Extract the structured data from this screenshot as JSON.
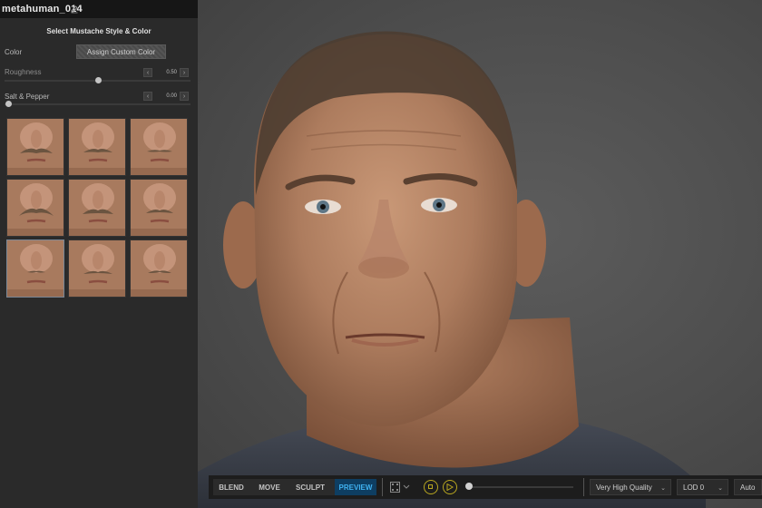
{
  "panel": {
    "title": "metahuman_014",
    "section_title": "Select Mustache Style & Color",
    "color": {
      "label": "Color",
      "button_label": "Assign Custom Color"
    },
    "roughness": {
      "label": "Roughness",
      "value": "0.50",
      "level": 0.5
    },
    "salt_pepper": {
      "label": "Salt & Pepper",
      "value": "0.00",
      "level": 0.0
    },
    "styles_count": 9,
    "selected_style_index": 6
  },
  "toolbar": {
    "modes": [
      "BLEND",
      "MOVE",
      "SCULPT",
      "PREVIEW"
    ],
    "active_mode": "PREVIEW",
    "quality": "Very High Quality",
    "lod": "LOD 0",
    "auto": "Auto",
    "accent_color": "#3fb1f0",
    "play_color": "#b8a620"
  }
}
